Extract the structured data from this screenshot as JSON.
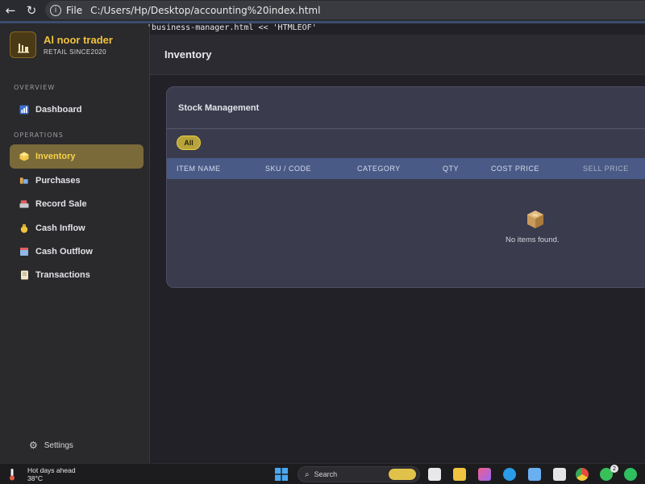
{
  "browser": {
    "file_label": "File",
    "url": "C:/Users/Hp/Desktop/accounting%20index.html"
  },
  "terminal_overlay": "'business-manager.html << 'HTMLEOF'",
  "brand": {
    "name": "Al noor trader",
    "tagline": "RETAIL SINCE2020"
  },
  "sidebar": {
    "sections": [
      {
        "label": "OVERVIEW"
      },
      {
        "label": "OPERATIONS"
      }
    ],
    "items": [
      {
        "label": "Dashboard",
        "icon": "chart-icon"
      },
      {
        "label": "Inventory",
        "icon": "cube-icon",
        "active": true
      },
      {
        "label": "Purchases",
        "icon": "cart-icon"
      },
      {
        "label": "Record Sale",
        "icon": "register-icon"
      },
      {
        "label": "Cash Inflow",
        "icon": "money-bag-icon"
      },
      {
        "label": "Cash Outflow",
        "icon": "outflow-icon"
      },
      {
        "label": "Transactions",
        "icon": "document-icon"
      }
    ],
    "settings_label": "Settings"
  },
  "page": {
    "title": "Inventory"
  },
  "stock": {
    "title": "Stock Management",
    "filter_all": "All",
    "columns": [
      "ITEM NAME",
      "SKU / CODE",
      "CATEGORY",
      "QTY",
      "COST PRICE",
      "SELL PRICE"
    ],
    "empty_text": "No items found."
  },
  "taskbar": {
    "weather_title": "Hot days ahead",
    "weather_temp": "38°C",
    "search_label": "Search",
    "badge_count": "2"
  },
  "colors": {
    "accent": "#f0c33c",
    "active_nav_bg": "#7a6a3a",
    "table_header_bg": "#4a5a86",
    "card_bg": "#3a3b4d"
  }
}
